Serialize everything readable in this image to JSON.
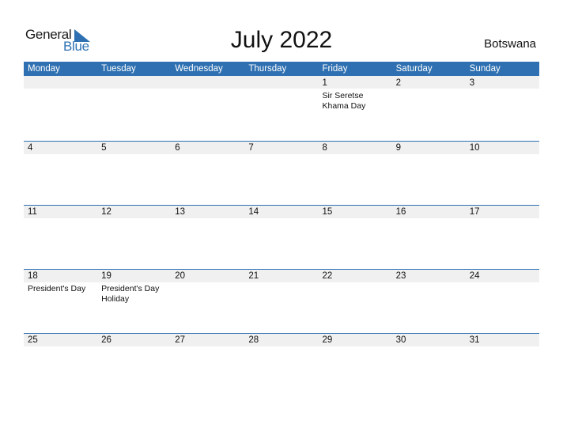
{
  "logo": {
    "general": "General",
    "blue": "Blue",
    "brand_color": "#2e70b1"
  },
  "title": "July 2022",
  "country": "Botswana",
  "weekdays": [
    "Monday",
    "Tuesday",
    "Wednesday",
    "Thursday",
    "Friday",
    "Saturday",
    "Sunday"
  ],
  "weeks": [
    {
      "days": [
        {
          "num": "",
          "event": ""
        },
        {
          "num": "",
          "event": ""
        },
        {
          "num": "",
          "event": ""
        },
        {
          "num": "",
          "event": ""
        },
        {
          "num": "1",
          "event": "Sir Seretse Khama Day"
        },
        {
          "num": "2",
          "event": ""
        },
        {
          "num": "3",
          "event": ""
        }
      ]
    },
    {
      "days": [
        {
          "num": "4",
          "event": ""
        },
        {
          "num": "5",
          "event": ""
        },
        {
          "num": "6",
          "event": ""
        },
        {
          "num": "7",
          "event": ""
        },
        {
          "num": "8",
          "event": ""
        },
        {
          "num": "9",
          "event": ""
        },
        {
          "num": "10",
          "event": ""
        }
      ]
    },
    {
      "days": [
        {
          "num": "11",
          "event": ""
        },
        {
          "num": "12",
          "event": ""
        },
        {
          "num": "13",
          "event": ""
        },
        {
          "num": "14",
          "event": ""
        },
        {
          "num": "15",
          "event": ""
        },
        {
          "num": "16",
          "event": ""
        },
        {
          "num": "17",
          "event": ""
        }
      ]
    },
    {
      "days": [
        {
          "num": "18",
          "event": "President's Day"
        },
        {
          "num": "19",
          "event": "President's Day Holiday"
        },
        {
          "num": "20",
          "event": ""
        },
        {
          "num": "21",
          "event": ""
        },
        {
          "num": "22",
          "event": ""
        },
        {
          "num": "23",
          "event": ""
        },
        {
          "num": "24",
          "event": ""
        }
      ]
    },
    {
      "days": [
        {
          "num": "25",
          "event": ""
        },
        {
          "num": "26",
          "event": ""
        },
        {
          "num": "27",
          "event": ""
        },
        {
          "num": "28",
          "event": ""
        },
        {
          "num": "29",
          "event": ""
        },
        {
          "num": "30",
          "event": ""
        },
        {
          "num": "31",
          "event": ""
        }
      ]
    }
  ]
}
